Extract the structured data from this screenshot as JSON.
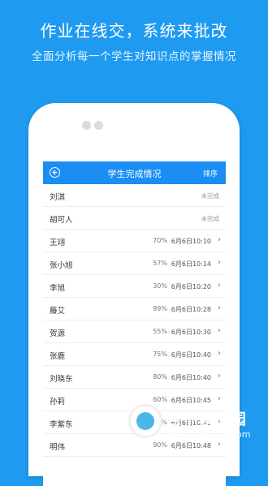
{
  "promo": {
    "headline": "作业在线交，系统来批改",
    "subline": "全面分析每一个学生对知识点的掌握情况"
  },
  "app": {
    "title": "学生完成情况",
    "sort_label": "排序",
    "back_icon": "back-arrow-icon"
  },
  "students": [
    {
      "name": "刘淇",
      "status": "未完成"
    },
    {
      "name": "胡可人",
      "status": "未完成"
    },
    {
      "name": "王翊",
      "percent": "70%",
      "time": "6月6日10:10"
    },
    {
      "name": "张小旭",
      "percent": "57%",
      "time": "6月6日10:14"
    },
    {
      "name": "李旭",
      "percent": "30%",
      "time": "6月6日10:20"
    },
    {
      "name": "藤艾",
      "percent": "89%",
      "time": "6月6日10:28"
    },
    {
      "name": "贺源",
      "percent": "55%",
      "time": "6月6日10:30"
    },
    {
      "name": "张鹿",
      "percent": "75%",
      "time": "6月6日10:40"
    },
    {
      "name": "刘晓东",
      "percent": "80%",
      "time": "6月6日10:40"
    },
    {
      "name": "孙莉",
      "percent": "60%",
      "time": "6月6日10:45"
    },
    {
      "name": "李紫东",
      "percent": "36%",
      "time": "6月6日10:46"
    },
    {
      "name": "明伟",
      "percent": "90%",
      "time": "6月6日10:48"
    }
  ],
  "watermark": {
    "text": "当下软件园",
    "url": "www.downxia.com"
  },
  "colors": {
    "background": "#1e9af1",
    "appbar": "#1a8ef3"
  }
}
